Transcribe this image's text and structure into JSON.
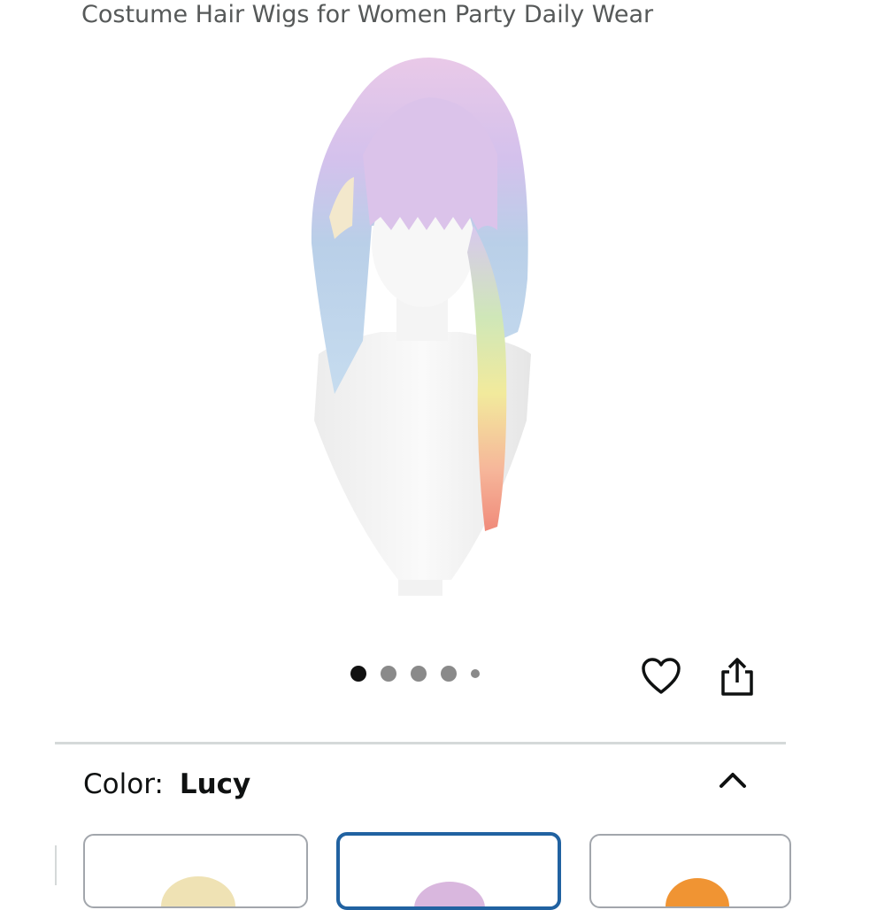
{
  "product": {
    "title": "Costume Hair Wigs for Women Party Daily Wear"
  },
  "gallery": {
    "dot_count": 5,
    "active_index": 0
  },
  "actions": {
    "favorite_icon": "heart-icon",
    "share_icon": "share-icon"
  },
  "variation": {
    "label": "Color:",
    "selected_value": "Lucy",
    "expanded": true,
    "swatch_colors": [
      "#efe2b4",
      "#d9b7de",
      "#f09433"
    ],
    "selected_swatch_index": 1
  },
  "colors": {
    "selected_border": "#2162a1",
    "swatch_border": "#a2a6ac",
    "divider": "#d5d9d9"
  }
}
